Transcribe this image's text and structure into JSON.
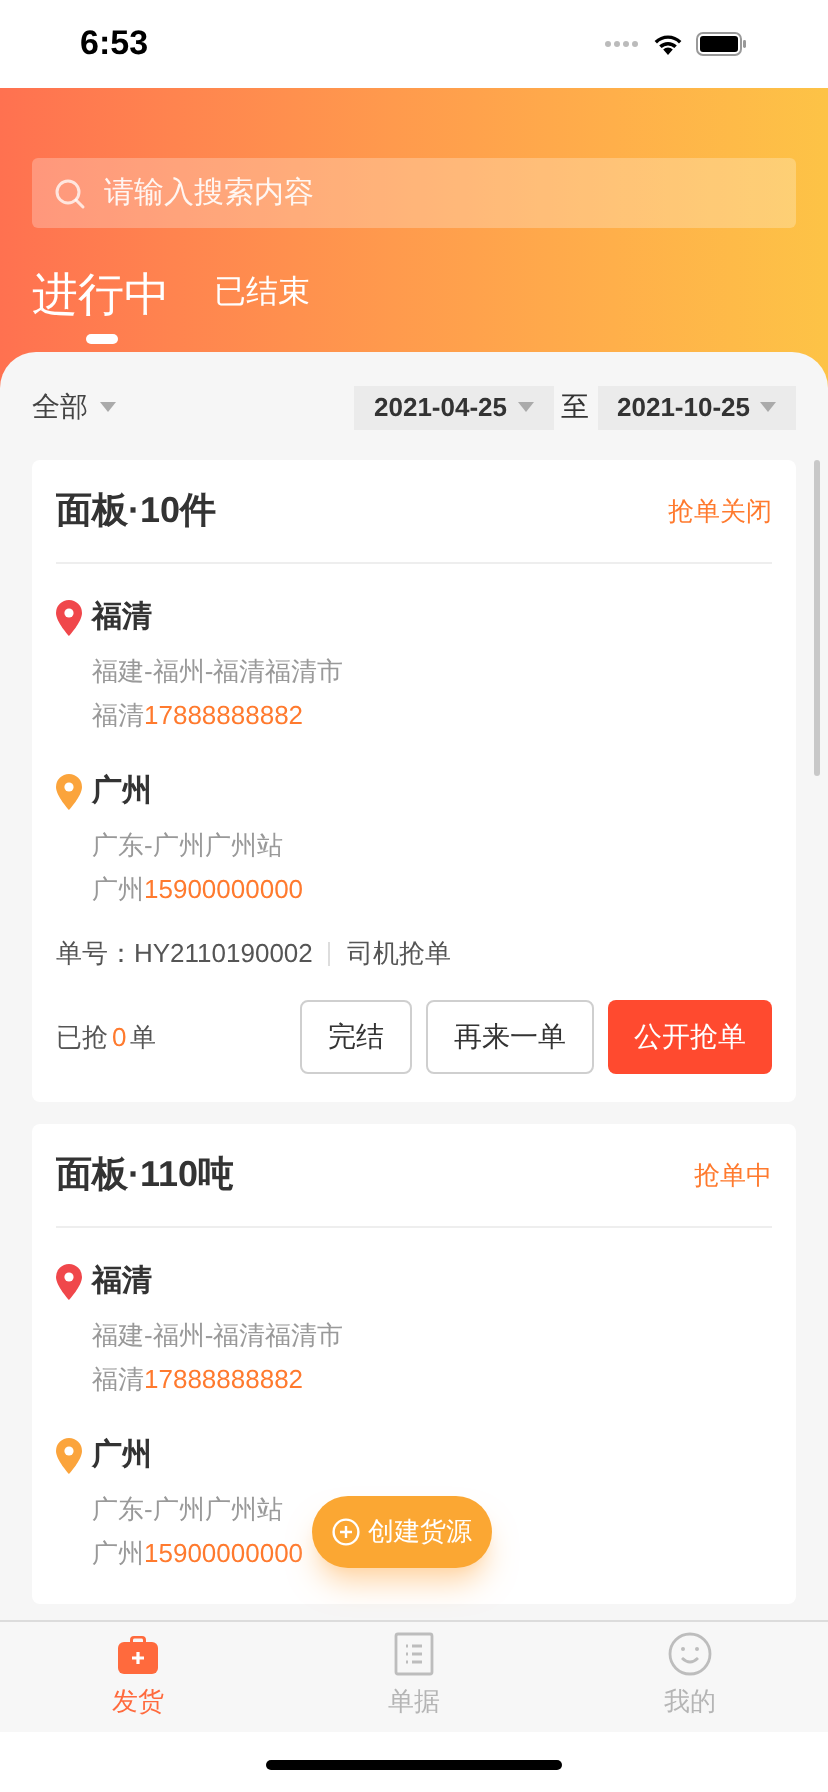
{
  "status_bar": {
    "time": "6:53"
  },
  "search": {
    "placeholder": "请输入搜索内容"
  },
  "tabs": [
    {
      "label": "进行中",
      "selected": true
    },
    {
      "label": "已结束",
      "selected": false
    }
  ],
  "filter": {
    "category": "全部",
    "start_date": "2021-04-25",
    "separator": "至",
    "end_date": "2021-10-25"
  },
  "orders": [
    {
      "title": "面板·10件",
      "status": "抢单关闭",
      "stops": [
        {
          "kind": "origin",
          "city": "福清",
          "address": "福建-福州-福清福清市",
          "contact": "福清",
          "phone": "17888888882"
        },
        {
          "kind": "destination",
          "city": "广州",
          "address": "广东-广州广州站",
          "contact": "广州",
          "phone": "15900000000"
        }
      ],
      "order_no": "单号：HY2110190002",
      "source": "司机抢单",
      "grabbed": {
        "prefix": "已抢",
        "count": "0",
        "suffix": "单"
      },
      "actions": [
        {
          "label": "完结",
          "kind": "outline"
        },
        {
          "label": "再来一单",
          "kind": "outline"
        },
        {
          "label": "公开抢单",
          "kind": "primary"
        }
      ]
    },
    {
      "title": "面板·110吨",
      "status": "抢单中",
      "stops": [
        {
          "kind": "origin",
          "city": "福清",
          "address": "福建-福州-福清福清市",
          "contact": "福清",
          "phone": "17888888882"
        },
        {
          "kind": "destination",
          "city": "广州",
          "address": "广东-广州广州站",
          "contact": "广州",
          "phone": "15900000000"
        }
      ]
    }
  ],
  "fab": {
    "label": "创建货源"
  },
  "tab_bar": [
    {
      "label": "发货",
      "kind": "box",
      "selected": true
    },
    {
      "label": "单据",
      "kind": "list",
      "selected": false
    },
    {
      "label": "我的",
      "kind": "face",
      "selected": false
    }
  ]
}
